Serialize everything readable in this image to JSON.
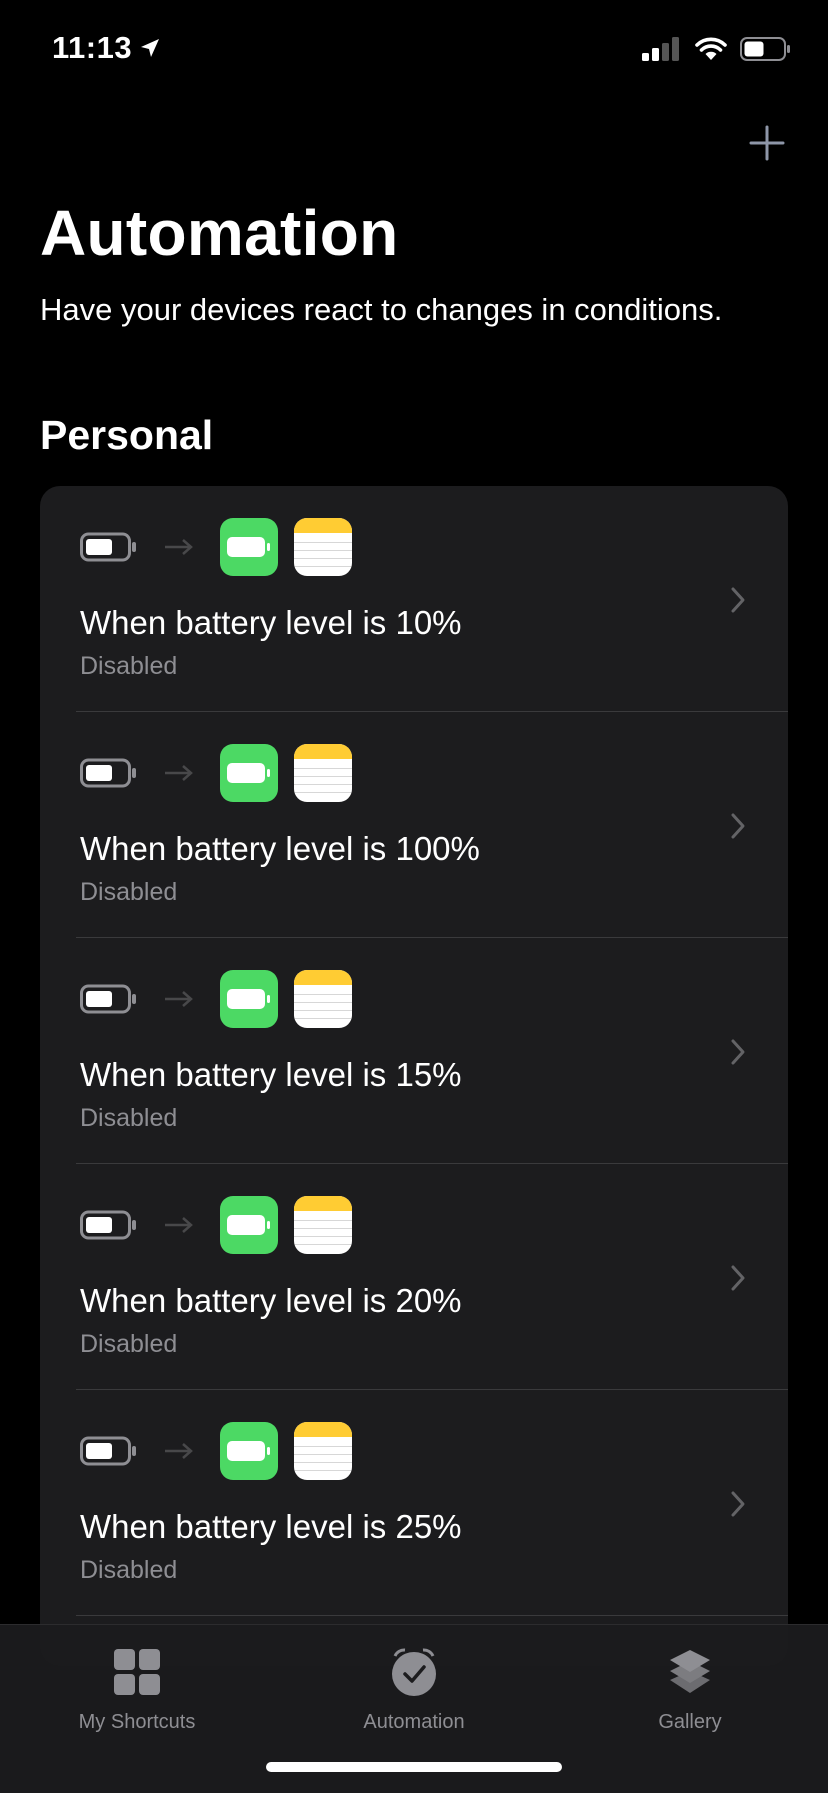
{
  "status_bar": {
    "time": "11:13"
  },
  "header": {
    "add_icon": "plus-icon",
    "title": "Automation",
    "subtitle": "Have your devices react to changes in conditions."
  },
  "section": {
    "title": "Personal"
  },
  "automations": [
    {
      "title": "When battery level is 10%",
      "status": "Disabled"
    },
    {
      "title": "When battery level is 100%",
      "status": "Disabled"
    },
    {
      "title": "When battery level is 15%",
      "status": "Disabled"
    },
    {
      "title": "When battery level is 20%",
      "status": "Disabled"
    },
    {
      "title": "When battery level is 25%",
      "status": "Disabled"
    }
  ],
  "tab_bar": {
    "tabs": [
      {
        "label": "My Shortcuts",
        "icon": "grid-icon"
      },
      {
        "label": "Automation",
        "icon": "clock-icon"
      },
      {
        "label": "Gallery",
        "icon": "stack-icon"
      }
    ]
  },
  "colors": {
    "background": "#000000",
    "card": "#1c1c1e",
    "secondary_text": "#8e8e93",
    "battery_app": "#4cd964",
    "notes_header": "#ffcc33",
    "tab_icon": "#8e8e93"
  }
}
